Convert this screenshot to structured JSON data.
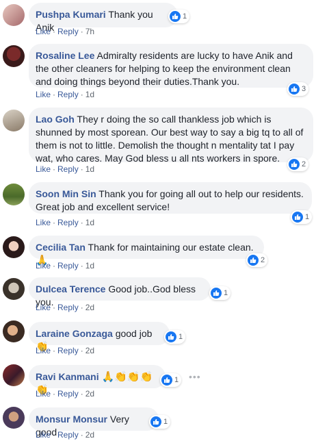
{
  "comments": [
    {
      "author": "Pushpa Kumari",
      "text": "Thank you Anik",
      "like": "Like",
      "reply": "Reply",
      "time": "7h",
      "reactions": "1"
    },
    {
      "author": "Rosaline Lee",
      "text": "Admiralty residents are lucky to have Anik and the other cleaners for helping to keep the environment clean and doing things beyond their duties.Thank you.",
      "like": "Like",
      "reply": "Reply",
      "time": "1d",
      "reactions": "3"
    },
    {
      "author": "Lao Goh",
      "text": "They r doing the so call thankless job which is shunned by most sporean. Our best way to say a big tq to all of them is not to little. Demolish the thought n mentality tat I pay wat, who cares. May God bless u all nts workers in spore.",
      "like": "Like",
      "reply": "Reply",
      "time": "1d",
      "reactions": "2"
    },
    {
      "author": "Soon Min Sin",
      "text": "Thank you for going all out to help our residents. Great job and excellent service!",
      "like": "Like",
      "reply": "Reply",
      "time": "1d",
      "reactions": "1"
    },
    {
      "author": "Cecilia Tan",
      "text": "Thank for maintaining our estate clean.",
      "emoji": "🙏",
      "like": "Like",
      "reply": "Reply",
      "time": "1d",
      "reactions": "2"
    },
    {
      "author": "Dulcea Terence",
      "text": "Good job..God bless you.",
      "like": "Like",
      "reply": "Reply",
      "time": "2d",
      "reactions": "1"
    },
    {
      "author": "Laraine Gonzaga",
      "text": "good job",
      "emoji": "👏",
      "like": "Like",
      "reply": "Reply",
      "time": "2d",
      "reactions": "1"
    },
    {
      "author": "Ravi Kanmani",
      "text": "",
      "emoji": "🙏👏👏👏👏",
      "like": "Like",
      "reply": "Reply",
      "time": "2d",
      "reactions": "1"
    },
    {
      "author": "Monsur Monsur",
      "text": "Very good",
      "like": "Like",
      "reply": "Reply",
      "time": "2d",
      "reactions": "1"
    }
  ],
  "colors": {
    "author": "#385898",
    "bubble": "#f2f3f5",
    "like_blue": "#1877f2",
    "meta": "#606770"
  },
  "icons": {
    "reaction": "like-icon",
    "more": "more-options-icon"
  }
}
